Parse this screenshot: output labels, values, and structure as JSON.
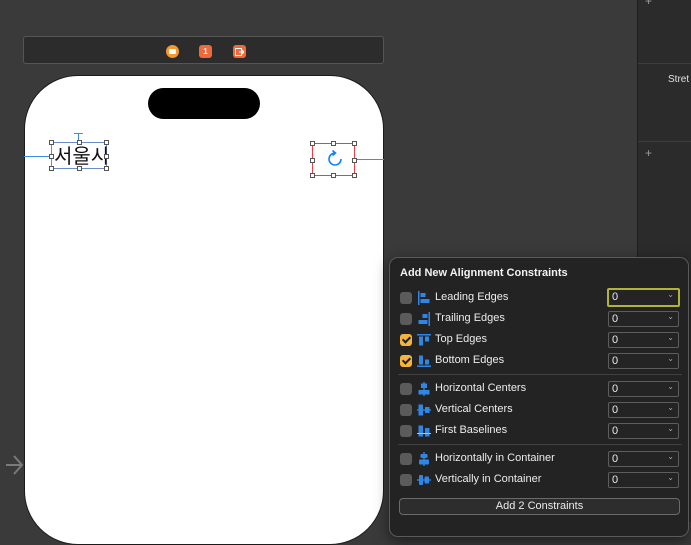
{
  "canvas": {
    "background": "#3a3a3b"
  },
  "inspector": {
    "label_partial": "Stret"
  },
  "scene_toolbar": {
    "icons": [
      "view-controller-icon",
      "first-responder-icon",
      "exit-icon"
    ],
    "first_responder_text": "1"
  },
  "device": {
    "label_text": "서울시",
    "button_icon": "refresh-icon"
  },
  "popover": {
    "title": "Add New Alignment Constraints",
    "groups": [
      [
        {
          "label": "Leading Edges",
          "checked": false,
          "value": "0",
          "icon": "leading-edges-icon",
          "focused": true
        },
        {
          "label": "Trailing Edges",
          "checked": false,
          "value": "0",
          "icon": "trailing-edges-icon"
        },
        {
          "label": "Top Edges",
          "checked": true,
          "value": "0",
          "icon": "top-edges-icon"
        },
        {
          "label": "Bottom Edges",
          "checked": true,
          "value": "0",
          "icon": "bottom-edges-icon"
        }
      ],
      [
        {
          "label": "Horizontal Centers",
          "checked": false,
          "value": "0",
          "icon": "horizontal-centers-icon"
        },
        {
          "label": "Vertical Centers",
          "checked": false,
          "value": "0",
          "icon": "vertical-centers-icon"
        },
        {
          "label": "First Baselines",
          "checked": false,
          "value": "0",
          "icon": "first-baselines-icon"
        }
      ],
      [
        {
          "label": "Horizontally in Container",
          "checked": false,
          "value": "0",
          "icon": "horizontally-in-container-icon"
        },
        {
          "label": "Vertically in Container",
          "checked": false,
          "value": "0",
          "icon": "vertically-in-container-icon"
        }
      ]
    ],
    "add_button_label": "Add 2 Constraints"
  },
  "colors": {
    "accent_blue": "#0a84ff",
    "checkbox_checked": "#f4b53f",
    "focus_ring": "#b1b33a"
  }
}
